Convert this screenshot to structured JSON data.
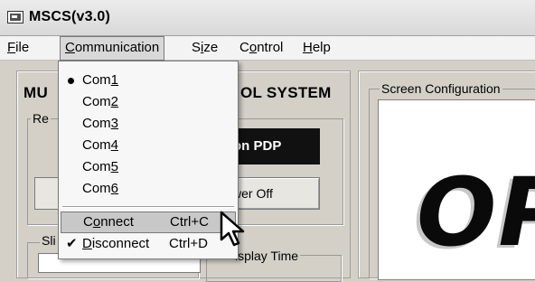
{
  "window": {
    "title": "MSCS(v3.0)"
  },
  "menubar": {
    "items": [
      {
        "label": "File",
        "underline": "F"
      },
      {
        "label": "Communication",
        "underline": "C"
      },
      {
        "label": "Size",
        "underline": "i"
      },
      {
        "label": "Control",
        "underline": "o"
      },
      {
        "label": "Help",
        "underline": "H"
      }
    ]
  },
  "communication_menu": {
    "ports": [
      {
        "label": "Com1",
        "selected": true
      },
      {
        "label": "Com2",
        "selected": false
      },
      {
        "label": "Com3",
        "selected": false
      },
      {
        "label": "Com4",
        "selected": false
      },
      {
        "label": "Com5",
        "selected": false
      },
      {
        "label": "Com6",
        "selected": false
      }
    ],
    "connect": {
      "label": "Connect",
      "shortcut": "Ctrl+C",
      "highlighted": true
    },
    "disconnect": {
      "label": "Disconnect",
      "shortcut": "Ctrl+D",
      "checked": true
    }
  },
  "left_panel": {
    "heading_left": "MU",
    "heading_right": "OL SYSTEM",
    "group1_legend": "Re",
    "dark_button": "on PDP",
    "power_button": "wer Off",
    "group2_legend": "Sli",
    "display_time_legend": "isplay Time"
  },
  "right_panel": {
    "legend": "Screen Configuration",
    "preview_text": "OP"
  },
  "icons": {
    "app_icon": "monitor-icon",
    "cursor": "mouse-pointer-icon"
  },
  "colors": {
    "window_bg": "#d4d0c8",
    "menu_highlight": "#c8c8c8",
    "dark_button": "#111111"
  }
}
